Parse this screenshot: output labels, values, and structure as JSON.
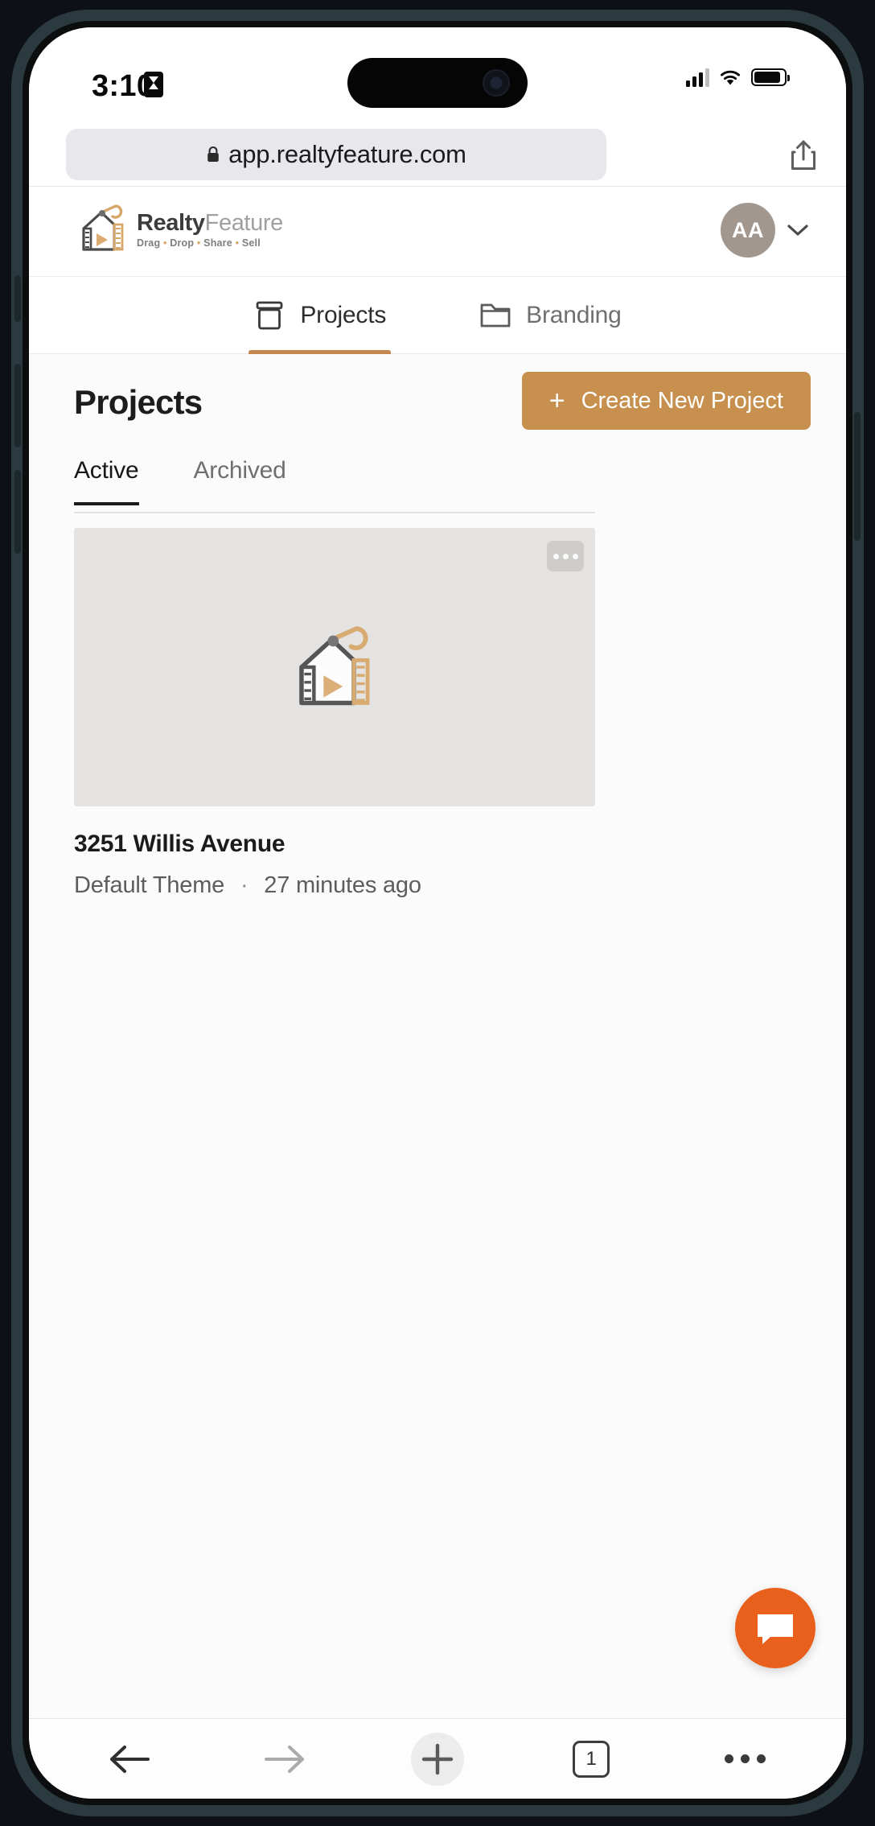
{
  "status_bar": {
    "time": "3:10",
    "time_icon": "hourglass-icon",
    "signal_icon": "cellular-signal-icon",
    "wifi_icon": "wifi-icon",
    "battery_icon": "battery-icon",
    "battery_level": 80
  },
  "browser": {
    "url": "app.realtyfeature.com",
    "lock_icon": "lock-icon",
    "share_icon": "share-icon",
    "nav": {
      "back_icon": "arrow-left-icon",
      "forward_icon": "arrow-right-icon",
      "new_tab_icon": "plus-icon",
      "tabs_count": "1",
      "more_icon": "ellipsis-icon"
    }
  },
  "app_header": {
    "logo_icon": "realtyfeature-logo-icon",
    "brand_name_bold": "Realty",
    "brand_name_light": "Feature",
    "tagline_parts": [
      "Drag",
      "Drop",
      "Share",
      "Sell"
    ],
    "tagline_separator": "•",
    "avatar_initials": "AA",
    "chevron_icon": "chevron-down-icon"
  },
  "section_tabs": [
    {
      "label": "Projects",
      "icon": "archive-box-icon",
      "active": true
    },
    {
      "label": "Branding",
      "icon": "folder-icon",
      "active": false
    }
  ],
  "page": {
    "title": "Projects",
    "create_button_label": "Create New Project",
    "create_button_plus": "+",
    "filter_tabs": [
      {
        "label": "Active",
        "active": true
      },
      {
        "label": "Archived",
        "active": false
      }
    ]
  },
  "projects": [
    {
      "name": "3251 Willis Avenue",
      "theme": "Default Theme",
      "separator": "·",
      "updated": "27 minutes ago",
      "thumbnail_icon": "realtyfeature-logo-icon",
      "menu_icon": "ellipsis-icon"
    }
  ],
  "chat_widget": {
    "icon": "chat-bubble-icon"
  },
  "colors": {
    "accent": "#c8904f",
    "accent_tab_underline": "#c4884e",
    "chat_fab": "#e8601c",
    "avatar_bg": "#a2978e",
    "thumb_bg": "#e4e3e1",
    "logo_tan": "#d7a76a",
    "logo_dark": "#4a4a4a"
  }
}
